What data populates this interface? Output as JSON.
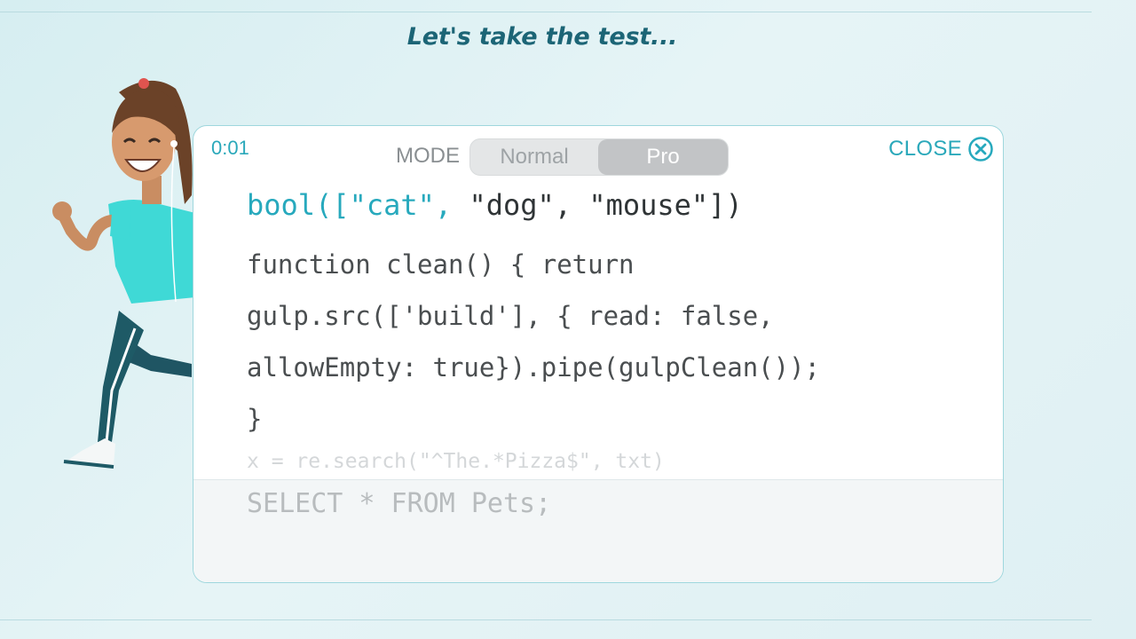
{
  "heading": "Let's take the test...",
  "quiz": {
    "timer": "0:01",
    "mode_label": "MODE",
    "mode_options": [
      "Normal",
      "Pro"
    ],
    "selected_mode": "Pro",
    "close_label": "CLOSE",
    "current_line": {
      "typed": "bool([\"cat\",",
      "remaining": " \"dog\", \"mouse\"])"
    },
    "upcoming_lines": [
      "function clean() { return",
      "gulp.src(['build'], { read: false,",
      "allowEmpty: true}).pipe(gulpClean());",
      "}",
      "x = re.search(\"^The.*Pizza$\", txt)",
      "SELECT * FROM Pets;"
    ]
  },
  "colors": {
    "accent": "#27a9bd",
    "heading": "#1c6576",
    "card_border": "#9fd7dd",
    "toggle_selected": "#c2c4c6"
  },
  "icons": [
    "close-circle-icon"
  ],
  "illustration": "running-woman-character"
}
